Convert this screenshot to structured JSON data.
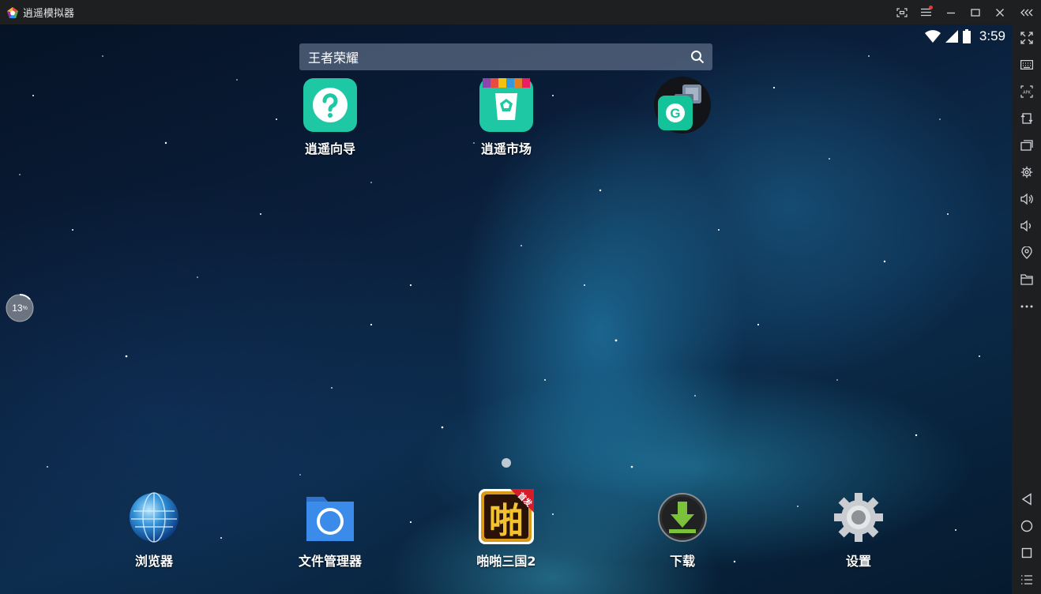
{
  "window": {
    "title": "逍遥模拟器"
  },
  "status": {
    "time": "3:59"
  },
  "search": {
    "text": "王者荣耀"
  },
  "desktop_apps": [
    {
      "label": "逍遥向导",
      "icon": "question-icon",
      "color": "#1ec8a5"
    },
    {
      "label": "逍遥市场",
      "icon": "market-bag-icon",
      "color": "#1ec8a5"
    },
    {
      "label": "",
      "icon": "grammarly-icon",
      "color": "#15c39a"
    }
  ],
  "dock_apps": [
    {
      "label": "浏览器",
      "icon": "globe-icon"
    },
    {
      "label": "文件管理器",
      "icon": "folder-icon"
    },
    {
      "label": "啪啪三国2",
      "icon": "game-icon",
      "badge": "首发"
    },
    {
      "label": "下载",
      "icon": "download-icon"
    },
    {
      "label": "设置",
      "icon": "gear-icon"
    }
  ],
  "float_ball": {
    "percent": "13",
    "unit": "%"
  },
  "colors": {
    "titlebar": "#1d1f21",
    "accent_teal": "#1ec8a5",
    "folder_blue": "#3b8bea"
  }
}
